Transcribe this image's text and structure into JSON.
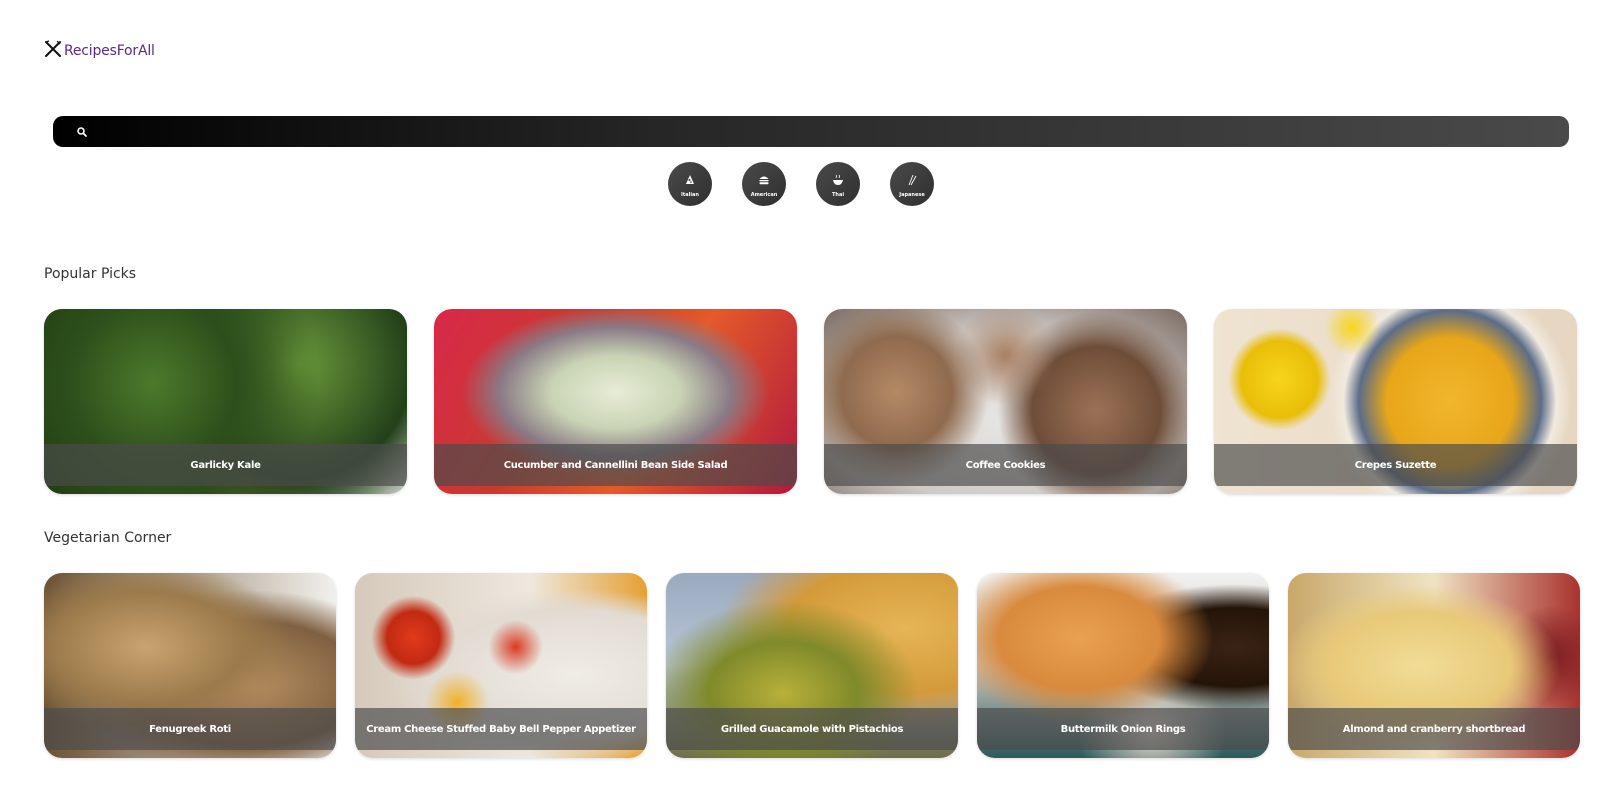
{
  "header": {
    "logo_text": "RecipesForAll",
    "logo_icon": "fork-knife-icon"
  },
  "search": {
    "placeholder": "",
    "value": "",
    "icon": "search-icon"
  },
  "categories": [
    {
      "label": "Italian",
      "icon": "pizza-icon"
    },
    {
      "label": "American",
      "icon": "burger-icon"
    },
    {
      "label": "Thai",
      "icon": "bowl-icon"
    },
    {
      "label": "Japanese",
      "icon": "chopsticks-icon"
    }
  ],
  "popular": {
    "title": "Popular Picks",
    "cards": [
      {
        "name": "Garlicky Kale"
      },
      {
        "name": "Cucumber and Cannellini Bean Side Salad"
      },
      {
        "name": "Coffee Cookies"
      },
      {
        "name": "Crepes Suzette"
      }
    ]
  },
  "vegetarian": {
    "title": "Vegetarian Corner",
    "cards": [
      {
        "name": "Fenugreek Roti"
      },
      {
        "name": "Cream Cheese Stuffed Baby Bell Pepper Appetizer"
      },
      {
        "name": "Grilled Guacamole with Pistachios"
      },
      {
        "name": "Buttermilk Onion Rings"
      },
      {
        "name": "Almond and cranberry shortbread"
      }
    ]
  },
  "colors": {
    "brand": "#5b2a86",
    "search_bar_start": "#000000",
    "search_bar_end": "#4a4a4a",
    "caption_overlay": "#4b4b4b"
  }
}
